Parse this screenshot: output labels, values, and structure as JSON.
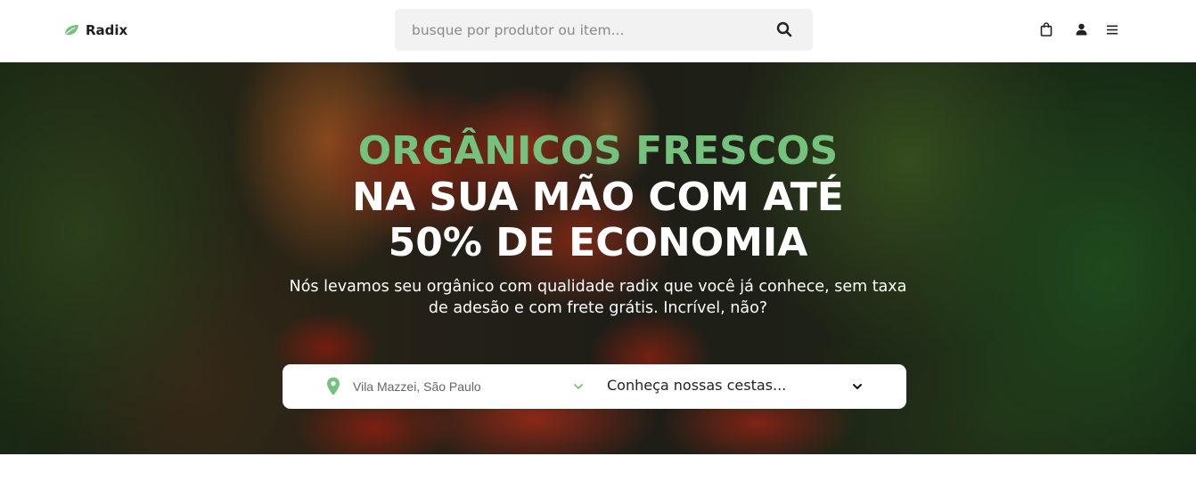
{
  "brand": {
    "name": "Radix",
    "accent": "#74c27e"
  },
  "header": {
    "search_placeholder": "busque por produtor ou item...",
    "icons": [
      "search-icon",
      "shopping-bag-icon",
      "user-icon",
      "menu-icon"
    ]
  },
  "hero": {
    "title_line1": "ORGÂNICOS FRESCOS",
    "title_line2": "NA SUA MÃO COM ATÉ",
    "title_line3": "50% DE ECONOMIA",
    "subtitle": "Nós levamos seu orgânico com qualidade radix que você já conhece, sem taxa de adesão e com frete grátis. Incrível, não?",
    "location": "Vila Mazzei, São Paulo",
    "cestas": "Conheça nossas cestas..."
  }
}
